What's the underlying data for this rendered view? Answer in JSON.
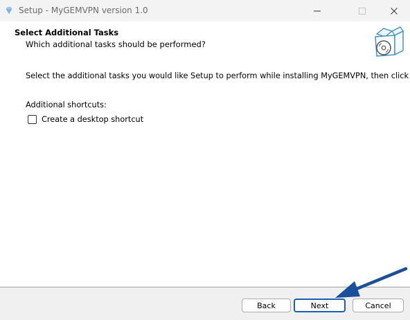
{
  "window": {
    "title": "Setup - MyGEMVPN version 1.0",
    "app_icon": "diamond-icon",
    "controls": [
      "minimize-icon",
      "maximize-icon",
      "close-icon"
    ]
  },
  "header": {
    "title": "Select Additional Tasks",
    "subtitle": "Which additional tasks should be performed?",
    "image": "box-disc-icon"
  },
  "body": {
    "instruction": "Select the additional tasks you would like Setup to perform while installing MyGEMVPN, then click Next.",
    "group_label": "Additional shortcuts:",
    "tasks": [
      {
        "label": "Create a desktop shortcut",
        "checked": false
      }
    ]
  },
  "buttons": {
    "back": "Back",
    "next": "Next",
    "cancel": "Cancel"
  },
  "annotation": {
    "arrow_color": "#1a4f9c",
    "target": "next-button"
  },
  "colors": {
    "accent": "#1a5fb4",
    "titlebar_bg": "#f3f3f3",
    "footer_bg": "#f0f0f0"
  }
}
